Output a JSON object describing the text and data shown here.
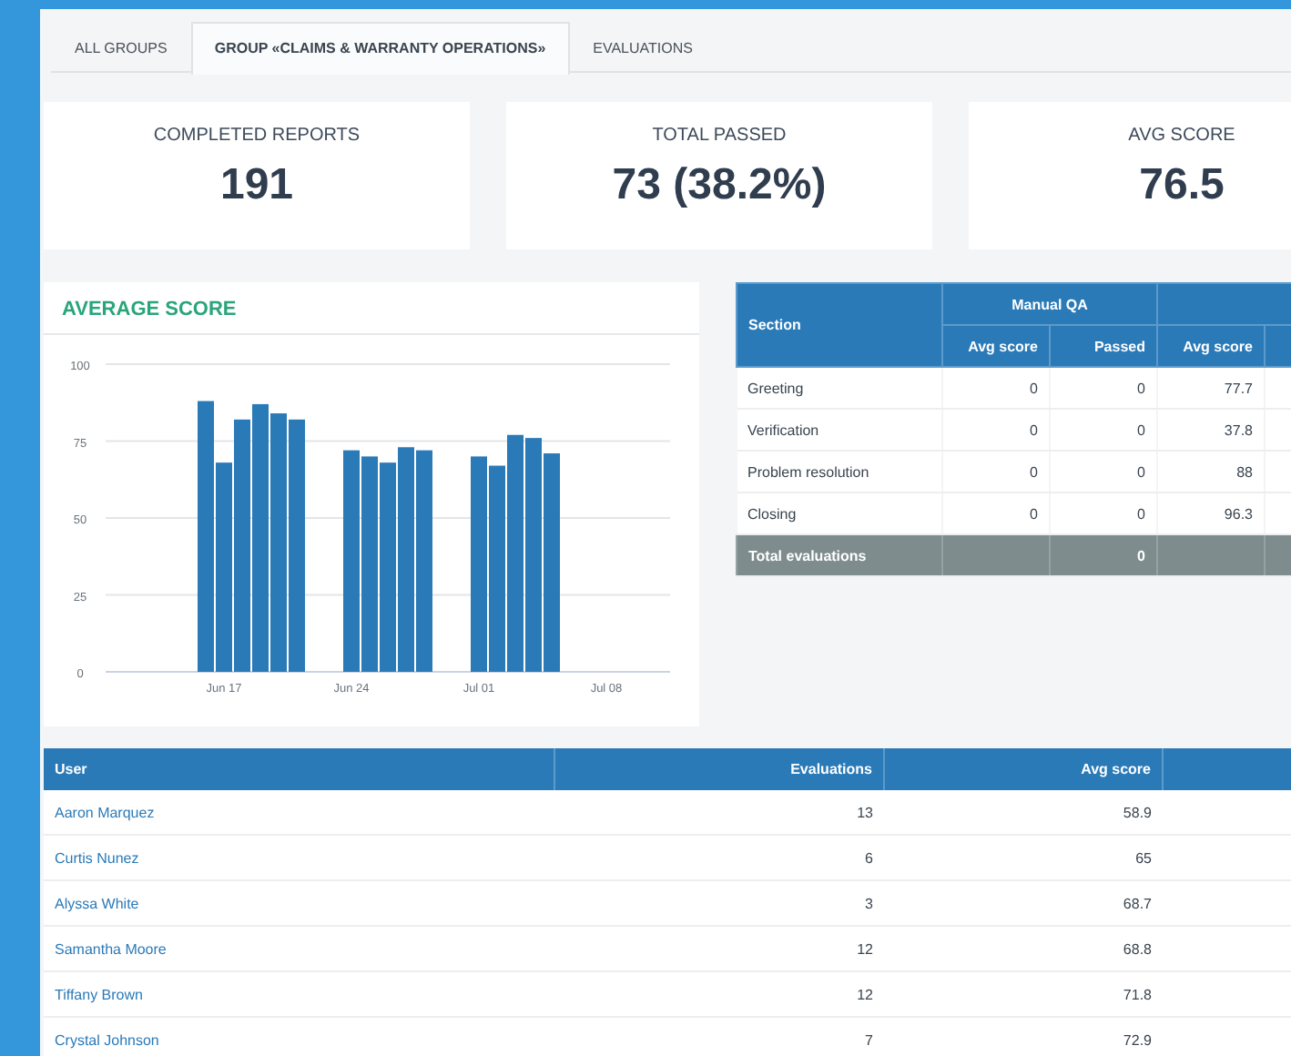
{
  "tabs": [
    {
      "label": "ALL GROUPS",
      "selected": false
    },
    {
      "label": "GROUP «CLAIMS & WARRANTY OPERATIONS»",
      "selected": true
    },
    {
      "label": "EVALUATIONS",
      "selected": false
    }
  ],
  "stats": [
    {
      "label": "COMPLETED REPORTS",
      "value": "191"
    },
    {
      "label": "TOTAL PASSED",
      "value": "73 (38.2%)"
    },
    {
      "label": "AVG SCORE",
      "value": "76.5"
    }
  ],
  "average_score": {
    "title": "AVERAGE SCORE",
    "chart_data": {
      "type": "bar",
      "categories": [
        null,
        null,
        null,
        null,
        null,
        null,
        "Jun 17",
        null,
        null,
        null,
        null,
        null,
        null,
        "Jun 24",
        null,
        null,
        null,
        null,
        null,
        null,
        "Jul 01",
        null,
        null,
        null,
        null,
        null,
        null,
        "Jul 08",
        null,
        null,
        null
      ],
      "values": [
        null,
        null,
        null,
        null,
        null,
        88,
        68,
        82,
        87,
        84,
        82,
        null,
        null,
        72,
        70,
        68,
        73,
        72,
        null,
        null,
        70,
        67,
        77,
        76,
        71,
        null,
        null,
        null,
        null,
        null,
        null
      ],
      "ylim": [
        0,
        100
      ],
      "grid": true,
      "yticks": [
        0,
        25,
        50,
        75,
        100
      ]
    }
  },
  "section_table": {
    "groups": [
      "Manual QA"
    ],
    "columns": [
      "Section",
      "Avg score",
      "Passed",
      "Avg score"
    ],
    "rows": [
      [
        "Greeting",
        "0",
        "0",
        "77.7"
      ],
      [
        "Verification",
        "0",
        "0",
        "37.8"
      ],
      [
        "Problem resolution",
        "0",
        "0",
        "88"
      ],
      [
        "Closing",
        "0",
        "0",
        "96.3"
      ]
    ],
    "total": {
      "label": "Total evaluations",
      "passed": "0"
    }
  },
  "user_table": {
    "columns": [
      "User",
      "Evaluations",
      "Avg score"
    ],
    "rows": [
      [
        "Aaron Marquez",
        "13",
        "58.9"
      ],
      [
        "Curtis Nunez",
        "6",
        "65"
      ],
      [
        "Alyssa White",
        "3",
        "68.7"
      ],
      [
        "Samantha Moore",
        "12",
        "68.8"
      ],
      [
        "Tiffany Brown",
        "12",
        "71.8"
      ],
      [
        "Crystal Johnson",
        "7",
        "72.9"
      ]
    ]
  }
}
